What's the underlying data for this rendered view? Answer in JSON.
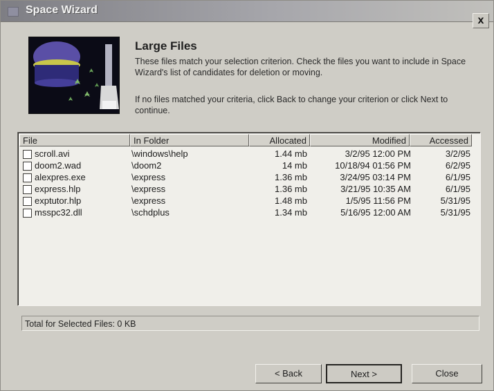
{
  "window": {
    "title": "Space Wizard",
    "close_label": "x"
  },
  "header": {
    "heading": "Large Files",
    "description": "These files match your selection criterion.  Check the files you want to include in Space Wizard's list of candidates for deletion or moving.",
    "instruction": "If no files matched your criteria, click Back to change your criterion or click Next to continue."
  },
  "table": {
    "columns": [
      "File",
      "In Folder",
      "Allocated",
      "Modified",
      "Accessed"
    ],
    "rows": [
      {
        "file": "scroll.avi",
        "folder": "\\windows\\help",
        "allocated": "1.44 mb",
        "modified": "3/2/95 12:00 PM",
        "accessed": "3/2/95"
      },
      {
        "file": "doom2.wad",
        "folder": "\\doom2",
        "allocated": "14 mb",
        "modified": "10/18/94 01:56 PM",
        "accessed": "6/2/95"
      },
      {
        "file": "alexpres.exe",
        "folder": "\\express",
        "allocated": "1.36 mb",
        "modified": "3/24/95 03:14 PM",
        "accessed": "6/1/95"
      },
      {
        "file": "express.hlp",
        "folder": "\\express",
        "allocated": "1.36 mb",
        "modified": "3/21/95 10:35 AM",
        "accessed": "6/1/95"
      },
      {
        "file": "exptutor.hlp",
        "folder": "\\express",
        "allocated": "1.48 mb",
        "modified": "1/5/95 11:56 PM",
        "accessed": "5/31/95"
      },
      {
        "file": "msspc32.dll",
        "folder": "\\schdplus",
        "allocated": "1.34 mb",
        "modified": "5/16/95 12:00 AM",
        "accessed": "5/31/95"
      }
    ]
  },
  "total": {
    "text": "Total for Selected Files: 0 KB"
  },
  "buttons": {
    "back": "< Back",
    "next": "Next >",
    "close": "Close"
  }
}
